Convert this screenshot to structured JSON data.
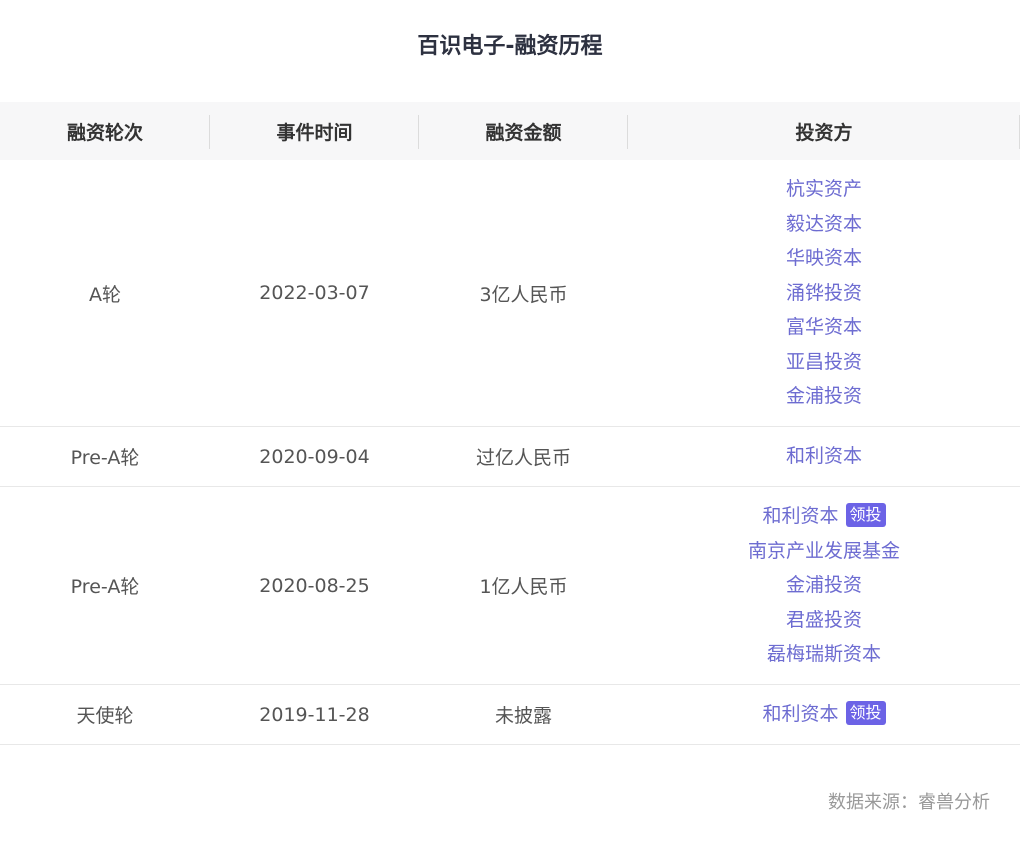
{
  "title": "百识电子-融资历程",
  "table": {
    "headers": [
      "融资轮次",
      "事件时间",
      "融资金额",
      "投资方"
    ],
    "rows": [
      {
        "round": "A轮",
        "date": "2022-03-07",
        "amount": "3亿人民币",
        "investors": [
          {
            "name": "杭实资产"
          },
          {
            "name": "毅达资本"
          },
          {
            "name": "华映资本"
          },
          {
            "name": "涌铧投资"
          },
          {
            "name": "富华资本"
          },
          {
            "name": "亚昌投资"
          },
          {
            "name": "金浦投资"
          }
        ]
      },
      {
        "round": "Pre-A轮",
        "date": "2020-09-04",
        "amount": "过亿人民币",
        "investors": [
          {
            "name": "和利资本"
          }
        ]
      },
      {
        "round": "Pre-A轮",
        "date": "2020-08-25",
        "amount": "1亿人民币",
        "investors": [
          {
            "name": "和利资本",
            "badge": "领投"
          },
          {
            "name": "南京产业发展基金"
          },
          {
            "name": "金浦投资"
          },
          {
            "name": "君盛投资"
          },
          {
            "name": "磊梅瑞斯资本"
          }
        ]
      },
      {
        "round": "天使轮",
        "date": "2019-11-28",
        "amount": "未披露",
        "investors": [
          {
            "name": "和利资本",
            "badge": "领投"
          }
        ]
      }
    ]
  },
  "source": "数据来源：睿兽分析",
  "colors": {
    "link": "#6d6cd1",
    "badge": "#6c63e6",
    "header_bg": "#f7f7f8"
  }
}
